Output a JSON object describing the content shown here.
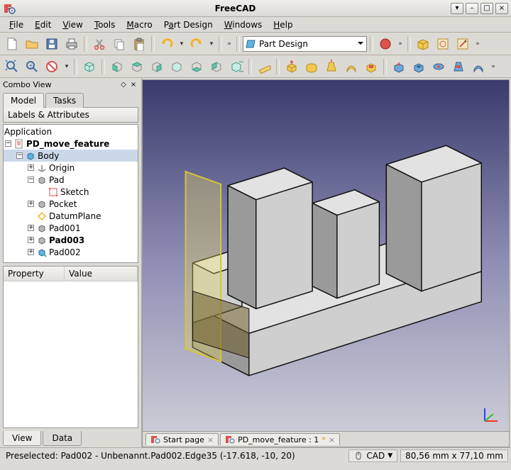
{
  "window": {
    "title": "FreeCAD",
    "min_icon": "–",
    "max_icon": "□",
    "close_icon": "×",
    "wedge_icon": "▾"
  },
  "menu": {
    "file": "File",
    "edit": "Edit",
    "view": "View",
    "tools": "Tools",
    "macro": "Macro",
    "part_design": "Part Design",
    "windows": "Windows",
    "help": "Help"
  },
  "toolbar": {
    "workbench": "Part Design",
    "chevron": "»"
  },
  "combo": {
    "title": "Combo View",
    "tab_model": "Model",
    "tab_tasks": "Tasks",
    "labels_attributes": "Labels & Attributes",
    "tree": {
      "application": "Application",
      "pd_move_feature": "PD_move_feature",
      "body": "Body",
      "origin": "Origin",
      "pad": "Pad",
      "sketch": "Sketch",
      "pocket": "Pocket",
      "datumplane": "DatumPlane",
      "pad001": "Pad001",
      "pad003": "Pad003",
      "pad002": "Pad002"
    },
    "property_header": "Property",
    "value_header": "Value",
    "tab_view": "View",
    "tab_data": "Data"
  },
  "doc_tabs": {
    "start_page": "Start page",
    "pd_move_feature": "PD_move_feature : 1",
    "close": "×",
    "modified": "*"
  },
  "status": {
    "preselected": "Preselected: Pad002 - Unbenannt.Pad002.Edge35 (-17.618, -10, 20)",
    "cad": "CAD",
    "dims": "80,56 mm x 77,10 mm"
  }
}
